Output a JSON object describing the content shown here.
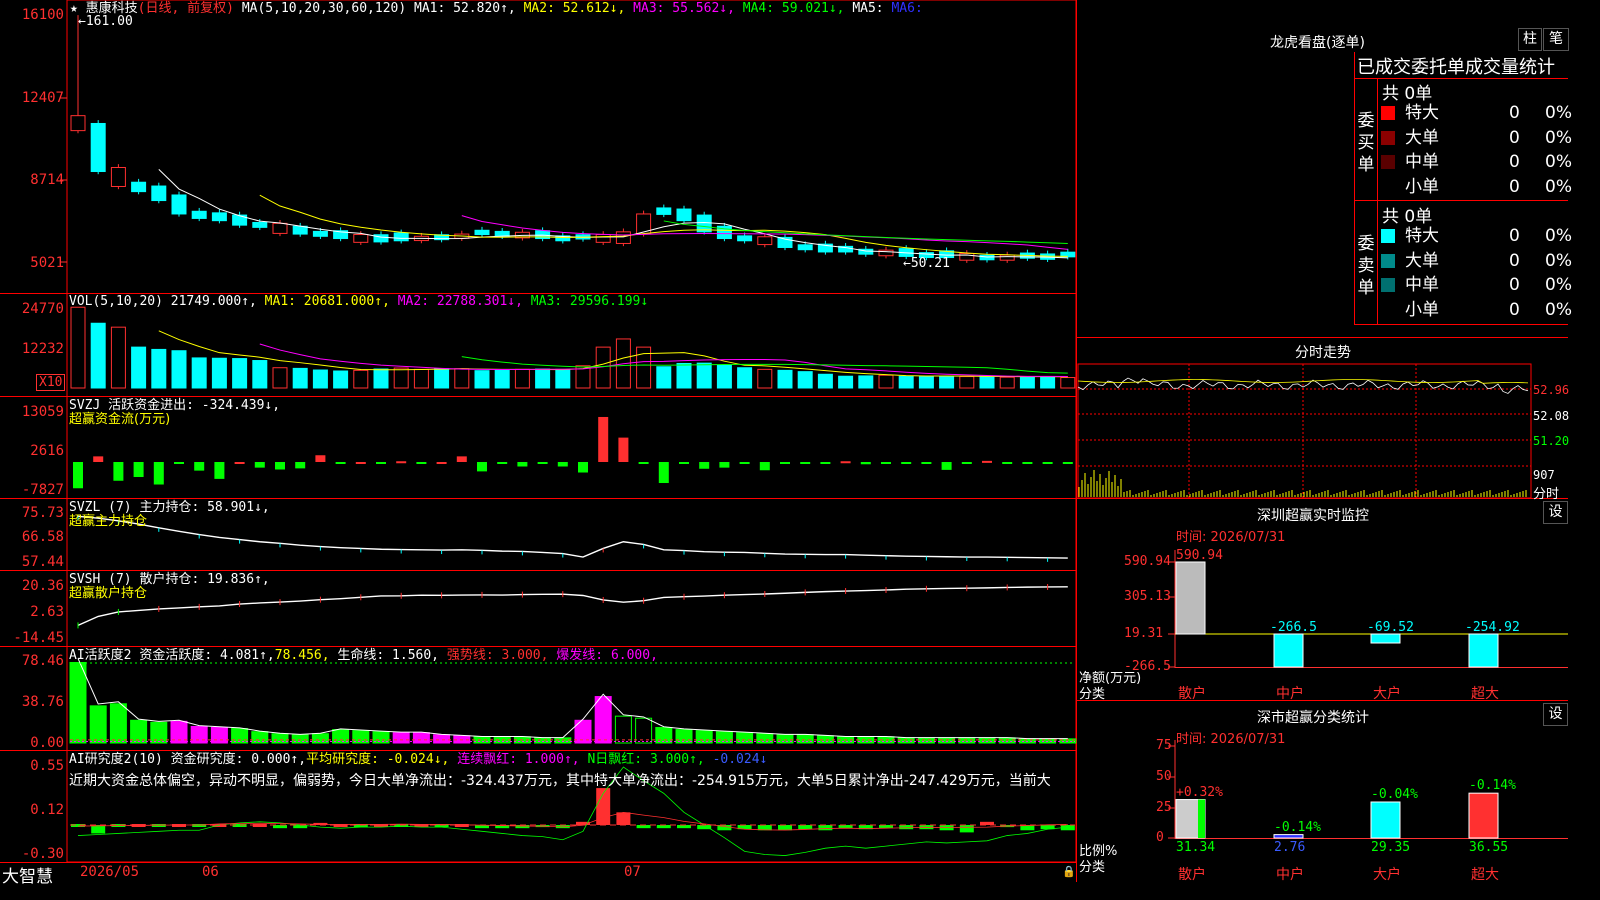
{
  "app": {
    "brand": "大智慧"
  },
  "main_chart": {
    "star": "★",
    "title": "惠康科技",
    "mode": "(日线, 前复权)",
    "ma_params": "MA(5,10,20,30,60,120)",
    "ma1": "MA1: 52.820↑,",
    "ma2": "MA2: 52.612↓,",
    "ma3": "MA3: 55.562↓,",
    "ma4": "MA4: 59.021↓,",
    "ma5": "MA5:",
    "ma6": "MA6:",
    "yticks": [
      "16100",
      "12407",
      "8714",
      "5021"
    ],
    "high_label": "←161.00",
    "low_label": "←50.21"
  },
  "vol_panel": {
    "name": "VOL(5,10,20)",
    "value": "21749.000↑,",
    "ma1": "MA1: 20681.000↑,",
    "ma2": "MA2: 22788.301↓,",
    "ma3": "MA3: 29596.199↓",
    "yticks": [
      "24770",
      "12232"
    ],
    "unit": "X10"
  },
  "svzj_panel": {
    "name": "SVZJ",
    "desc": "活跃资金进出: -324.439↓,",
    "sub": "超赢资金流(万元)",
    "yticks": [
      "13059",
      "2616",
      "-7827"
    ]
  },
  "svzl_panel": {
    "name": "SVZL (7)",
    "desc": "主力持仓: 58.901↓,",
    "sub": "超赢主力持仓",
    "yticks": [
      "75.73",
      "66.58",
      "57.44"
    ]
  },
  "svsh_panel": {
    "name": "SVSH (7)",
    "desc": "散户持仓: 19.836↑,",
    "sub": "超赢散户持仓",
    "yticks": [
      "20.36",
      "2.63",
      "-14.45"
    ]
  },
  "ai_active_panel": {
    "name": "AI活跃度2",
    "desc": "资金活跃度: 4.081↑,",
    "v2": "78.456,",
    "life": "生命线: 1.560,",
    "strong": "强势线: 3.000,",
    "burst": "爆发线: 6.000,",
    "yticks": [
      "78.46",
      "38.76",
      "0.00"
    ]
  },
  "ai_research_panel": {
    "name": "AI研究度2(10)",
    "desc": "资金研究度: 0.000↑,",
    "avg": "平均研究度: -0.024↓,",
    "red1": "连续飘红: 1.000↑,",
    "red2": "N日飘红: 3.000↑,",
    "last": "-0.024↓",
    "summary": "近期大资金总体偏空，异动不明显，偏弱势，今日大单净流出：-324.437万元，其中特大单净流出：-254.915万元，大单5日累计净出-247.429万元，当前大",
    "yticks": [
      "0.55",
      "0.12",
      "-0.30"
    ]
  },
  "x_axis": {
    "labels": [
      "2026/05",
      "06",
      "07"
    ]
  },
  "lhb": {
    "title": "龙虎看盘(逐单)",
    "btn_bar": "柱",
    "btn_pen": "笔",
    "header": "已成交委托单成交量统计",
    "buy_label": "委买单",
    "sell_label": "委卖单",
    "buy_total": "共 0单",
    "sell_total": "共 0单",
    "buy_rows": [
      {
        "label": "特大",
        "count": "0",
        "pct": "0%",
        "color": "#ff0000"
      },
      {
        "label": "大单",
        "count": "0",
        "pct": "0%",
        "color": "#8b0000"
      },
      {
        "label": "中单",
        "count": "0",
        "pct": "0%",
        "color": "#5a0000"
      },
      {
        "label": "小单",
        "count": "0",
        "pct": "0%",
        "color": "#000000"
      }
    ],
    "sell_rows": [
      {
        "label": "特大",
        "count": "0",
        "pct": "0%",
        "color": "#00ffff"
      },
      {
        "label": "大单",
        "count": "0",
        "pct": "0%",
        "color": "#008b8b"
      },
      {
        "label": "中单",
        "count": "0",
        "pct": "0%",
        "color": "#007070"
      },
      {
        "label": "小单",
        "count": "0",
        "pct": "0%",
        "color": "#000000"
      }
    ]
  },
  "intraday": {
    "title": "分时走势",
    "p1": "52.96",
    "p2": "52.08",
    "p3": "51.20",
    "vol": "907",
    "unit": "分时"
  },
  "sz_monitor": {
    "title": "深圳超赢实时监控",
    "settings": "设",
    "time": "时间: 2026/07/31",
    "yticks": [
      "590.94",
      "305.13",
      "19.31",
      "-266.5"
    ],
    "ylabel1": "净额(万元)",
    "ylabel2": "分类",
    "bars": [
      {
        "cat": "散户",
        "value": 590.94,
        "label": "590.94"
      },
      {
        "cat": "中户",
        "value": -266.5,
        "label": "-266.5"
      },
      {
        "cat": "大户",
        "value": -69.52,
        "label": "-69.52"
      },
      {
        "cat": "超大",
        "value": -254.92,
        "label": "-254.92"
      }
    ]
  },
  "sz_class": {
    "title": "深市超赢分类统计",
    "settings": "设",
    "time": "时间: 2026/07/31",
    "yticks": [
      "75",
      "50",
      "25",
      "0"
    ],
    "ylabel1": "比例%",
    "ylabel2": "分类",
    "bars": [
      {
        "cat": "散户",
        "value": 31.34,
        "label": "31.34",
        "chg": "+0.32%",
        "chg_color": "#ff3030"
      },
      {
        "cat": "中户",
        "value": 2.76,
        "label": "2.76",
        "chg": "-0.14%",
        "chg_color": "#00ff00"
      },
      {
        "cat": "大户",
        "value": 29.35,
        "label": "29.35",
        "chg": "-0.04%",
        "chg_color": "#00ff00"
      },
      {
        "cat": "超大",
        "value": 36.55,
        "label": "36.55",
        "chg": "-0.14%",
        "chg_color": "#00ff00"
      }
    ]
  },
  "colors": {
    "up": "#ff3030",
    "down": "#00ffff",
    "grid": "#ff0000",
    "yellow": "#ffff00",
    "magenta": "#ff00ff",
    "green": "#00ff00"
  }
}
